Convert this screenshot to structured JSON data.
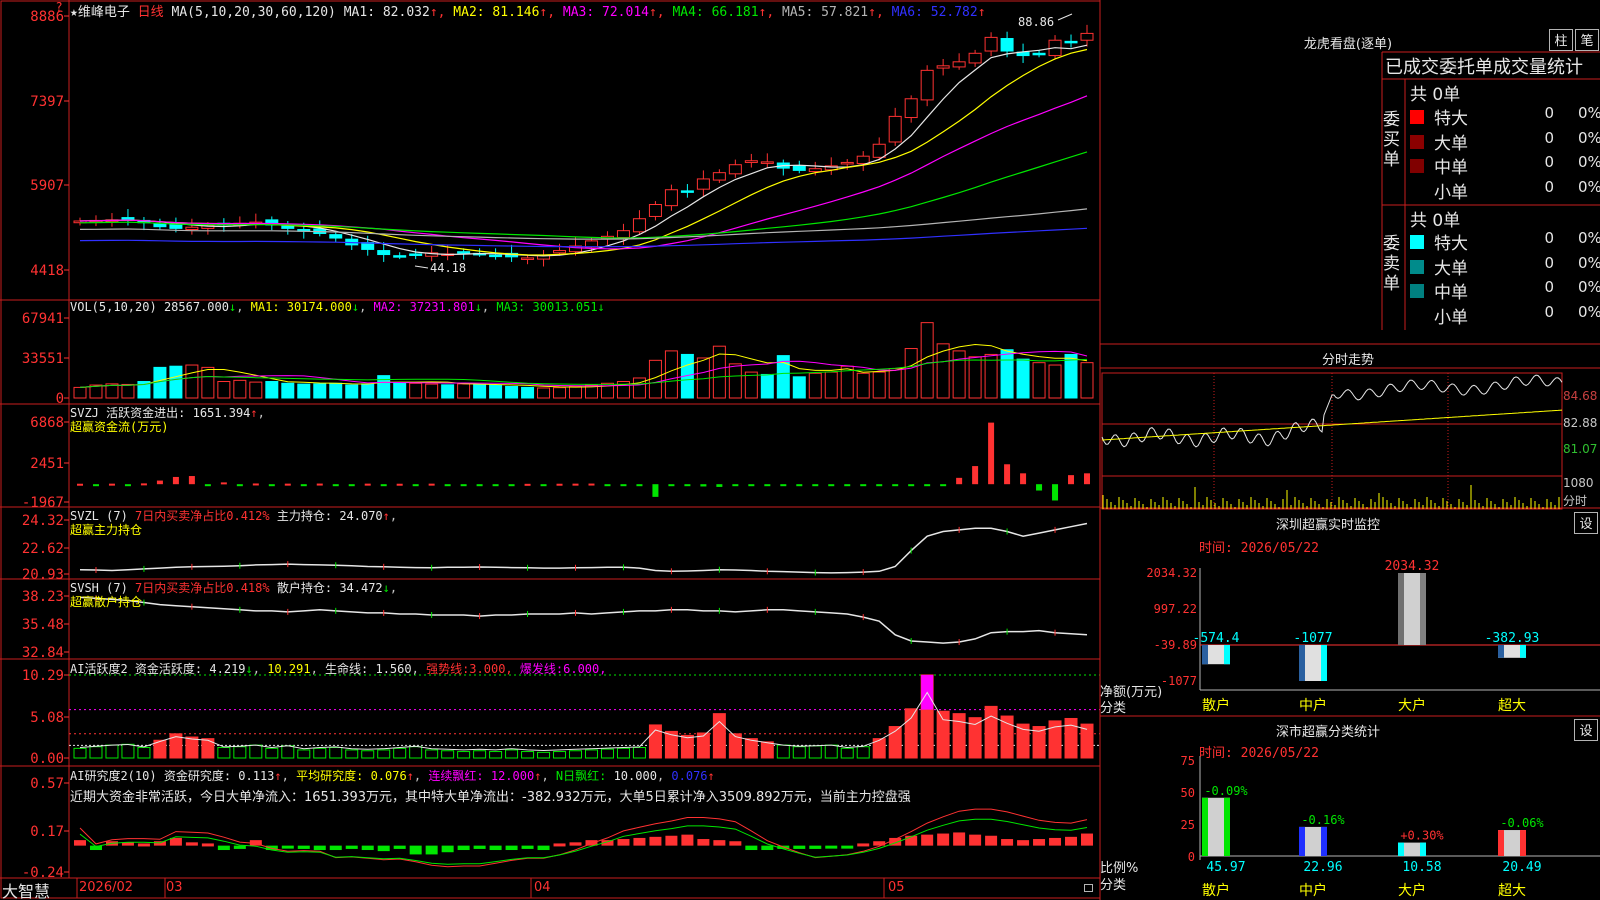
{
  "main": {
    "stock_name": "维峰电子",
    "star": "★",
    "period": "日线",
    "ma_label": "MA(5,10,20,30,60,120)",
    "ma_values": [
      {
        "name": "MA1",
        "value": "82.032",
        "color": "#e6e6e6"
      },
      {
        "name": "MA2",
        "value": "81.146",
        "color": "#ffff00"
      },
      {
        "name": "MA3",
        "value": "72.014",
        "color": "#ff00ff"
      },
      {
        "name": "MA4",
        "value": "66.181",
        "color": "#00e600"
      },
      {
        "name": "MA5",
        "value": "57.821",
        "color": "#b4b4b4"
      },
      {
        "name": "MA6",
        "value": "52.782",
        "color": "#3030ff"
      }
    ],
    "yaxis_labels": [
      "8886",
      "7397",
      "5907",
      "4418"
    ],
    "corner_mark": "?",
    "high_label": "88.86",
    "low_label": "44.18"
  },
  "vol": {
    "label": "VOL(5,10,20)",
    "value": "28567.000",
    "ma1": "30174.000",
    "ma2": "37231.801",
    "ma3": "30013.051",
    "yaxis_labels": [
      "67941",
      "33551",
      "0"
    ]
  },
  "svzj": {
    "label": "SVZJ",
    "desc": "活跃资金进出:",
    "value": "1651.394",
    "subtitle": "超赢资金流(万元)",
    "yaxis_labels": [
      "6868",
      "2451",
      "-1967"
    ]
  },
  "svzl": {
    "label": "SVZL (7)",
    "text1": "7日内买卖净占比0.412%",
    "text2": "主力持仓:",
    "value": "24.070",
    "subtitle": "超赢主力持仓",
    "yaxis_labels": [
      "24.32",
      "22.62",
      "20.93"
    ]
  },
  "svsh": {
    "label": "SVSH (7)",
    "text1": "7日内买卖净占比0.418%",
    "text2": "散户持仓:",
    "value": "34.472",
    "subtitle": "超赢散户持仓",
    "yaxis_labels": [
      "38.23",
      "35.48",
      "32.84"
    ]
  },
  "ai_active": {
    "label": "AI活跃度2",
    "text1": "资金活跃度:",
    "v1": "4.219",
    "v2": "10.291",
    "text2": "生命线:",
    "v3": "1.560",
    "strong_label": "强势线:",
    "strong_value": "3.000",
    "burst_label": "爆发线:",
    "burst_value": "6.000",
    "yaxis_labels": [
      "10.29",
      "5.08",
      "0.00"
    ]
  },
  "ai_research": {
    "label": "AI研究度2(10)",
    "text1": "资金研究度:",
    "v1": "0.113",
    "text2": "平均研究度:",
    "v2": "0.076",
    "text3": "连续飘红:",
    "v3": "12.000",
    "text4": "N日飘红:",
    "v4": "10.000",
    "v5": "0.076",
    "note": "近期大资金非常活跃，今日大单净流入：1651.393万元，其中特大单净流出：-382.932万元，大单5日累计净入3509.892万元，当前主力控盘强",
    "yaxis_labels": [
      "0.57",
      "0.17",
      "-0.24"
    ]
  },
  "footer": {
    "brand": "大智慧",
    "dates": [
      "2026/02",
      "03",
      "04",
      "05"
    ]
  },
  "lhb": {
    "title": "龙虎看盘(逐单)",
    "btn1": "柱",
    "btn2": "笔",
    "header": "已成交委托单成交量统计",
    "buy_label": "委买单",
    "sell_label": "委卖单",
    "buy_total": "共 0单",
    "sell_total": "共 0单",
    "buy_rows": [
      {
        "label": "特大",
        "num": "0",
        "pct": "0%",
        "color": "#ff0000"
      },
      {
        "label": "大单",
        "num": "0",
        "pct": "0%",
        "color": "#8b0000"
      },
      {
        "label": "中单",
        "num": "0",
        "pct": "0%",
        "color": "#800000"
      },
      {
        "label": "小单",
        "num": "0",
        "pct": "0%",
        "color": ""
      }
    ],
    "sell_rows": [
      {
        "label": "特大",
        "num": "0",
        "pct": "0%",
        "color": "#00ffff"
      },
      {
        "label": "大单",
        "num": "0",
        "pct": "0%",
        "color": "#008b8b"
      },
      {
        "label": "中单",
        "num": "0",
        "pct": "0%",
        "color": "#008080"
      },
      {
        "label": "小单",
        "num": "0",
        "pct": "0%",
        "color": ""
      }
    ]
  },
  "intraday": {
    "title": "分时走势",
    "yaxis_labels": [
      "84.68",
      "82.88",
      "81.07"
    ],
    "vol_label": "1080",
    "vol_unit": "分时"
  },
  "monitor": {
    "title": "深圳超赢实时监控",
    "btn": "设",
    "time": "时间: 2026/05/22",
    "yaxis_labels": [
      "2034.32",
      "997.22",
      "-39.89",
      "-1077"
    ],
    "ylabel": "净额(万元)",
    "xlabel": "分类",
    "categories": [
      "散户",
      "中户",
      "大户",
      "超大"
    ],
    "values": [
      "-574.4",
      "-1077",
      "2034.32",
      "-382.93"
    ]
  },
  "classify": {
    "title": "深市超赢分类统计",
    "btn": "设",
    "time": "时间: 2026/05/22",
    "yaxis_labels": [
      "75",
      "50",
      "25",
      "0"
    ],
    "ylabel": "比例%",
    "xlabel": "分类",
    "categories": [
      "散户",
      "中户",
      "大户",
      "超大"
    ],
    "values": [
      "45.97",
      "22.96",
      "10.58",
      "20.49"
    ],
    "changes": [
      "-0.09%",
      "-0.16%",
      "+0.30%",
      "-0.06%"
    ]
  },
  "chart_data": [
    {
      "type": "candlestick",
      "title": "维峰电子 日线",
      "ylim": [
        44.18,
        88.86
      ],
      "x_labels": [
        "2026/02",
        "03",
        "04",
        "05"
      ],
      "close": [
        52.8,
        52.9,
        53.0,
        53.1,
        52.5,
        51.8,
        51.5,
        51.7,
        52.0,
        52.2,
        52.4,
        52.6,
        52.1,
        51.5,
        51.0,
        50.6,
        49.8,
        48.6,
        47.8,
        46.9,
        46.6,
        46.8,
        47.2,
        47.0,
        47.3,
        47.0,
        46.7,
        46.5,
        46.3,
        46.8,
        47.6,
        48.4,
        49.3,
        50.1,
        51.1,
        53.2,
        55.7,
        58.3,
        58.0,
        60.2,
        61.3,
        62.7,
        63.4,
        63.2,
        62.1,
        61.7,
        62.0,
        62.5,
        63.1,
        64.2,
        66.3,
        71.2,
        74.3,
        79.3,
        80.1,
        80.8,
        82.3,
        85.1,
        82.7,
        81.9,
        82.1,
        84.6,
        84.2,
        85.8
      ]
    },
    {
      "type": "bar",
      "title": "VOL(5,10,20)",
      "ylim": [
        0,
        67941
      ],
      "values": [
        9000,
        11000,
        12000,
        11500,
        14000,
        26000,
        27000,
        28000,
        26000,
        14000,
        15000,
        13500,
        14000,
        12500,
        11800,
        12000,
        12500,
        11000,
        12000,
        19000,
        13000,
        12500,
        11800,
        11200,
        12000,
        11500,
        11000,
        9800,
        9000,
        8500,
        8800,
        10000,
        11000,
        12500,
        14000,
        17000,
        32000,
        40000,
        37000,
        34000,
        44000,
        29000,
        22000,
        20000,
        36000,
        18000,
        21000,
        22000,
        27000,
        21000,
        22000,
        25000,
        42000,
        64000,
        46000,
        40000,
        35000,
        37000,
        41000,
        33000,
        30000,
        28000,
        37000,
        30000
      ]
    },
    {
      "type": "bar",
      "title": "超赢资金流(万元)",
      "ylim": [
        -1967,
        6868
      ],
      "values": [
        50,
        -80,
        60,
        -100,
        90,
        400,
        800,
        900,
        -150,
        200,
        -120,
        80,
        -90,
        60,
        -110,
        70,
        -80,
        -90,
        60,
        -70,
        50,
        -90,
        60,
        -80,
        -100,
        -70,
        -60,
        -50,
        40,
        -80,
        50,
        60,
        70,
        -60,
        -70,
        -50,
        -1400,
        -150,
        -200,
        -250,
        -300,
        -120,
        -180,
        -140,
        -120,
        -130,
        -150,
        -90,
        -80,
        -80,
        -110,
        -60,
        -80,
        -100,
        -90,
        700,
        2000,
        6800,
        2200,
        1200,
        -700,
        -1800,
        1000,
        1200
      ]
    },
    {
      "type": "line",
      "title": "超赢主力持仓",
      "ylim": [
        20.93,
        24.32
      ],
      "values": [
        21.2,
        21.18,
        21.15,
        21.2,
        21.25,
        21.3,
        21.35,
        21.38,
        21.4,
        21.42,
        21.45,
        21.5,
        21.52,
        21.55,
        21.52,
        21.5,
        21.48,
        21.45,
        21.4,
        21.38,
        21.35,
        21.33,
        21.32,
        21.35,
        21.36,
        21.37,
        21.35,
        21.33,
        21.32,
        21.3,
        21.3,
        21.32,
        21.33,
        21.35,
        21.35,
        21.3,
        21.15,
        21.1,
        21.12,
        21.15,
        21.2,
        21.18,
        21.15,
        21.1,
        21.08,
        21.05,
        21.02,
        21.0,
        21.02,
        21.05,
        21.1,
        21.4,
        22.4,
        23.3,
        23.6,
        23.7,
        23.8,
        23.8,
        23.6,
        23.3,
        23.5,
        23.7,
        23.9,
        24.1
      ]
    },
    {
      "type": "line",
      "title": "超赢散户持仓",
      "ylim": [
        32.84,
        38.23
      ],
      "values": [
        38.1,
        38.0,
        37.9,
        37.8,
        37.6,
        37.4,
        37.3,
        37.2,
        37.1,
        37.0,
        36.9,
        36.8,
        36.8,
        36.7,
        36.8,
        36.9,
        36.8,
        36.7,
        36.6,
        36.6,
        36.5,
        36.5,
        36.4,
        36.4,
        36.4,
        36.3,
        36.4,
        36.4,
        36.5,
        36.5,
        36.5,
        36.6,
        36.5,
        36.6,
        36.7,
        36.8,
        36.8,
        36.9,
        36.9,
        36.8,
        36.8,
        36.7,
        36.8,
        36.9,
        36.9,
        36.8,
        36.7,
        36.6,
        36.5,
        36.2,
        35.8,
        34.5,
        33.9,
        33.8,
        33.7,
        33.8,
        34.1,
        34.7,
        34.8,
        34.8,
        34.9,
        34.7,
        34.6,
        34.5
      ]
    },
    {
      "type": "bar",
      "title": "AI活跃度2",
      "ylim": [
        0,
        10.29
      ],
      "values": [
        1.2,
        1.4,
        1.6,
        1.7,
        1.3,
        2.2,
        3.0,
        2.6,
        2.4,
        1.3,
        1.4,
        1.6,
        1.2,
        1.5,
        1.0,
        1.2,
        1.3,
        1.0,
        0.9,
        1.0,
        1.2,
        1.4,
        1.0,
        0.9,
        0.8,
        0.9,
        0.8,
        1.0,
        0.8,
        0.7,
        0.8,
        0.9,
        1.0,
        1.1,
        1.2,
        1.3,
        4.1,
        3.3,
        2.8,
        3.1,
        5.5,
        3.0,
        2.4,
        2.0,
        1.6,
        1.4,
        1.5,
        1.6,
        1.2,
        1.4,
        2.4,
        3.9,
        6.1,
        10.3,
        5.8,
        5.5,
        5.0,
        6.4,
        5.2,
        4.2,
        3.9,
        4.6,
        4.9,
        4.2
      ]
    },
    {
      "type": "bar",
      "title": "AI研究度2(10)",
      "ylim": [
        -0.24,
        0.57
      ],
      "values": [
        0.05,
        -0.04,
        0.04,
        0.03,
        0.02,
        0.04,
        0.07,
        0.03,
        0.02,
        -0.04,
        -0.03,
        0.05,
        -0.04,
        -0.02,
        -0.03,
        -0.04,
        -0.04,
        -0.03,
        -0.04,
        -0.05,
        -0.03,
        -0.08,
        -0.08,
        -0.06,
        -0.04,
        -0.03,
        -0.04,
        -0.04,
        -0.03,
        -0.04,
        0.02,
        0.03,
        0.05,
        0.05,
        0.06,
        0.07,
        0.08,
        0.09,
        0.1,
        0.06,
        0.05,
        0.04,
        -0.04,
        -0.04,
        -0.03,
        -0.03,
        -0.03,
        -0.02,
        -0.02,
        0.02,
        0.04,
        0.07,
        0.09,
        0.1,
        0.11,
        0.12,
        0.1,
        0.09,
        0.06,
        0.05,
        0.06,
        0.07,
        0.08,
        0.11
      ]
    },
    {
      "type": "bar",
      "title": "深圳超赢实时监控",
      "categories": [
        "散户",
        "中户",
        "大户",
        "超大"
      ],
      "values": [
        -574.4,
        -1077,
        2034.32,
        -382.93
      ],
      "ylabel": "净额(万元)",
      "ylim": [
        -1077,
        2034.32
      ]
    },
    {
      "type": "bar",
      "title": "深市超赢分类统计",
      "categories": [
        "散户",
        "中户",
        "大户",
        "超大"
      ],
      "values": [
        45.97,
        22.96,
        10.58,
        20.49
      ],
      "ylabel": "比例%",
      "ylim": [
        0,
        75
      ]
    }
  ]
}
